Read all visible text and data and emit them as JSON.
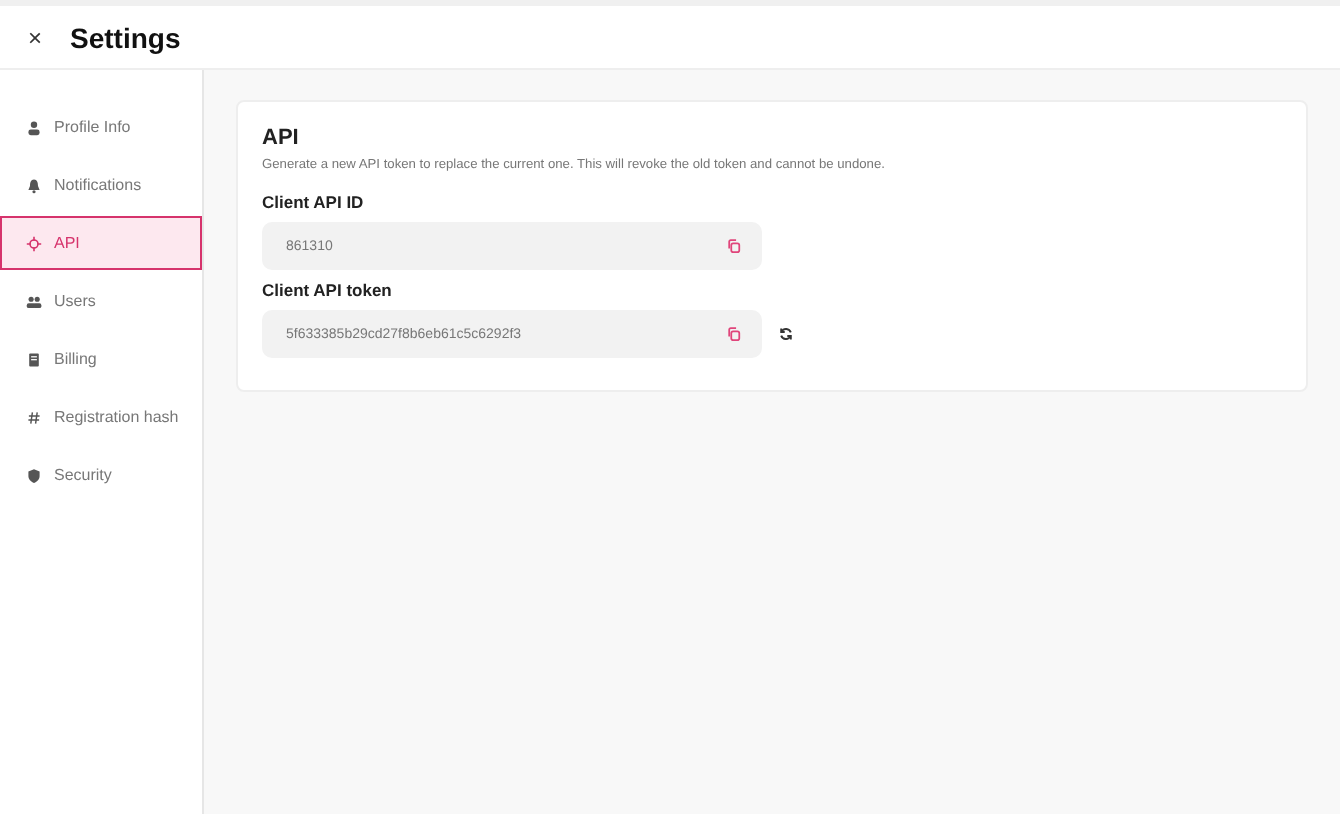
{
  "header": {
    "close": "×",
    "title": "Settings"
  },
  "sidebar": {
    "items": [
      {
        "label": "Profile Info",
        "kind": "person",
        "selected": false
      },
      {
        "label": "Notifications",
        "kind": "bell",
        "selected": false
      },
      {
        "label": "API",
        "kind": "api",
        "selected": true
      },
      {
        "label": "Users",
        "kind": "people",
        "selected": false
      },
      {
        "label": "Billing",
        "kind": "doc",
        "selected": false
      },
      {
        "label": "Registration hash",
        "kind": "hash",
        "selected": false
      },
      {
        "label": "Security",
        "kind": "shield",
        "selected": false
      }
    ]
  },
  "card": {
    "title": "API",
    "description": "Generate a new API token to replace the current one. This will revoke the old token and cannot be undone.",
    "fields": [
      {
        "label": "Client API ID",
        "value": "861310",
        "refresh_button": false
      },
      {
        "label": "Client API token",
        "value": "5f633385b29cd27f8b6eb61c5c6292f3",
        "refresh_button": true
      }
    ]
  }
}
